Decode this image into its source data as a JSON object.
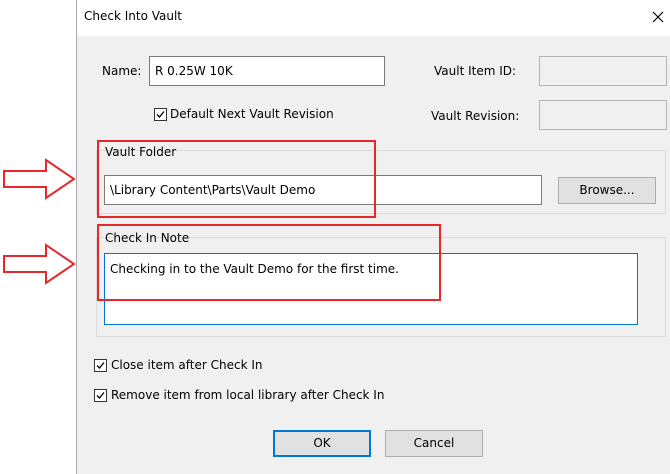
{
  "dialog": {
    "title": "Check Into Vault",
    "close_icon": "close-icon"
  },
  "form": {
    "name_label": "Name:",
    "name_value": "R 0.25W 10K",
    "vault_item_id_label": "Vault Item ID:",
    "vault_item_id_value": "",
    "default_next_revision_label": "Default Next Vault Revision",
    "default_next_revision_checked": true,
    "vault_revision_label": "Vault Revision:",
    "vault_revision_value": ""
  },
  "vault_folder": {
    "label": "Vault Folder",
    "path": "\\Library Content\\Parts\\Vault Demo",
    "browse_label": "Browse..."
  },
  "check_in_note": {
    "label": "Check In Note",
    "text": "Checking in to the Vault Demo for the first time."
  },
  "options": {
    "close_after_label": "Close item after Check In",
    "close_after_checked": true,
    "remove_from_library_label": "Remove item from local library after Check In",
    "remove_from_library_checked": true
  },
  "buttons": {
    "ok_label": "OK",
    "cancel_label": "Cancel"
  },
  "annotations": {
    "highlight_color": "#e8272c",
    "arrow_icon": "right-arrow-icon"
  }
}
